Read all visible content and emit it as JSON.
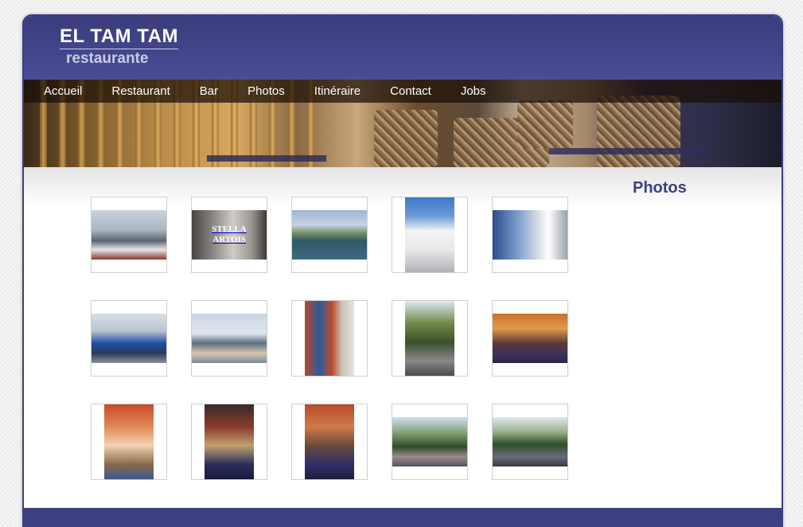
{
  "site": {
    "title": "EL TAM TAM",
    "subtitle": "restaurante"
  },
  "nav": [
    {
      "label": "Accueil",
      "name": "nav-accueil"
    },
    {
      "label": "Restaurant",
      "name": "nav-restaurant"
    },
    {
      "label": "Bar",
      "name": "nav-bar"
    },
    {
      "label": "Photos",
      "name": "nav-photos"
    },
    {
      "label": "Itinéraire",
      "name": "nav-itineraire"
    },
    {
      "label": "Contact",
      "name": "nav-contact"
    },
    {
      "label": "Jobs",
      "name": "nav-jobs"
    }
  ],
  "sidebar": {
    "title": "Photos"
  },
  "gallery": [
    {
      "name": "marina-boats-photo",
      "orientation": "landscape",
      "bg": "linear-gradient(#c9d3dc 0%, #aab6c2 40%, #5d6470 62%, #e6e6ea 80%, #8a3a2a 100%)"
    },
    {
      "name": "stella-artois-window-photo",
      "orientation": "landscape",
      "bg": "linear-gradient(90deg, #4a4440 0%, #8e8a86 30%, #cfcbc6 55%, #9b9690 80%, #3d3935 100%)",
      "caption": "STELLA ARTOIS"
    },
    {
      "name": "canal-view-photo",
      "orientation": "landscape",
      "bg": "linear-gradient(#9fb6d4 0%, #c7d3e2 30%, #6f8a5c 48%, #2f5a6a 62%, #3b6a80 100%)"
    },
    {
      "name": "lighthouse-photo",
      "orientation": "portrait",
      "bg": "linear-gradient(#3d79c8 0%, #6b9ad6 25%, #f4f4f4 45%, #e8e8e8 70%, #b0b0b8 100%)"
    },
    {
      "name": "el-tam-tam-terrace-photo",
      "orientation": "landscape",
      "bg": "linear-gradient(90deg, #2b4d8c 0%, #7fa0cf 35%, #d5dbe4 60%, #ffffff 75%, #9aa0aa 100%)"
    },
    {
      "name": "blue-boat-photo",
      "orientation": "landscape",
      "bg": "linear-gradient(#d8dfe6 0%, #b9c4cf 35%, #1f4fa6 60%, #2b3a5a 80%, #8a8f98 100%)"
    },
    {
      "name": "yacht-deck-photo",
      "orientation": "landscape",
      "bg": "linear-gradient(#c8d6e4 0%, #dfe6ee 40%, #5a6f80 60%, #d9c7b0 80%, #7a8a96 100%)"
    },
    {
      "name": "menu-board-photo",
      "orientation": "portrait",
      "bg": "linear-gradient(90deg, #b84a2a 0%, #2a5aa0 30%, #c04a2a 55%, #c9c2ba 75%, #e9e3dc 100%)"
    },
    {
      "name": "palm-tree-photo",
      "orientation": "portrait",
      "bg": "linear-gradient(#dfe8f0 0%, #6f8a4a 30%, #3b4f2a 55%, #8a8a8a 80%, #4a4a50 100%)"
    },
    {
      "name": "terrace-tables-photo",
      "orientation": "landscape",
      "bg": "linear-gradient(#c8702a 0%, #e09a4a 30%, #5a3a3a 60%, #3a2f5a 85%, #2a2545 100%)"
    },
    {
      "name": "interior-bar-photo",
      "orientation": "portrait",
      "bg": "linear-gradient(#c94a2a 0%, #e08a5a 30%, #f2d2b0 55%, #8a6a4a 80%, #3a5a8a 100%)"
    },
    {
      "name": "interior-tables-photo",
      "orientation": "portrait",
      "bg": "linear-gradient(#3a2a2a 0%, #8a3a2a 30%, #c0a070 55%, #2a2f5a 80%, #1a1a3a 100%)"
    },
    {
      "name": "dining-room-photo",
      "orientation": "portrait",
      "bg": "linear-gradient(#b84a2a 0%, #d07a4a 30%, #6a4a3a 55%, #2f2f6a 80%, #1f1f3a 100%)"
    },
    {
      "name": "promenade-palms-photo",
      "orientation": "landscape",
      "bg": "linear-gradient(#cfe0f0 0%, #7a9a6a 35%, #2f4a2a 60%, #9a8a8a 80%, #5a5060 100%)"
    },
    {
      "name": "street-palms-photo",
      "orientation": "landscape",
      "bg": "linear-gradient(#dfe8f2 0%, #9ab08a 30%, #2f4f2a 55%, #6a6a7a 80%, #3a3a45 100%)"
    }
  ]
}
